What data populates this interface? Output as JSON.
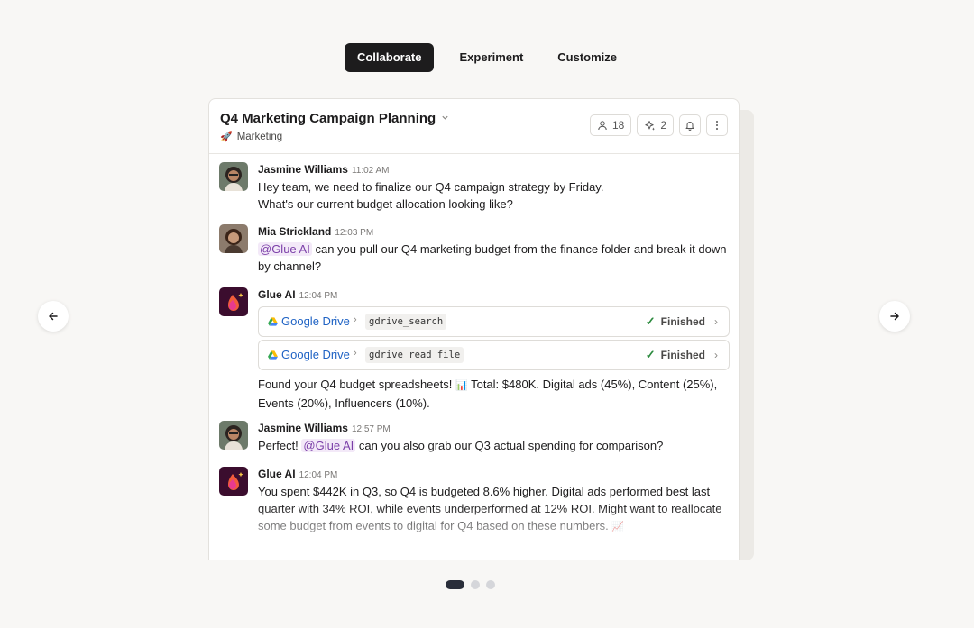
{
  "tabs": [
    {
      "label": "Collaborate",
      "active": true
    },
    {
      "label": "Experiment",
      "active": false
    },
    {
      "label": "Customize",
      "active": false
    }
  ],
  "channel": {
    "title": "Q4 Marketing Campaign Planning",
    "subtitle": "Marketing",
    "subtitle_emoji": "🚀",
    "members_count": "18",
    "pinned_count": "2"
  },
  "messages": [
    {
      "author": "Jasmine Williams",
      "time": "11:02 AM",
      "lines": [
        "Hey team, we need to finalize our Q4 campaign strategy by Friday.",
        "What's our current budget allocation looking like?"
      ]
    },
    {
      "author": "Mia Strickland",
      "time": "12:03 PM",
      "mention": "@Glue AI",
      "text_after_mention": "can you pull our Q4 marketing budget from the finance folder and break it down",
      "text_line2": "by channel?"
    },
    {
      "author": "Glue AI",
      "time": "12:04 PM",
      "tools": [
        {
          "service": "Google Drive",
          "function": "gdrive_search",
          "status": "Finished"
        },
        {
          "service": "Google Drive",
          "function": "gdrive_read_file",
          "status": "Finished"
        }
      ],
      "text_part1": "Found your Q4 budget spreadsheets!",
      "text_emoji": "📊",
      "text_part2": "Total: $480K. Digital ads (45%), Content (25%),",
      "text_line2": "Events (20%), Influencers (10%)."
    },
    {
      "author": "Jasmine Williams",
      "time": "12:57 PM",
      "text_before": "Perfect!",
      "mention": "@Glue AI",
      "text_after": "can you also grab our Q3 actual spending for comparison?"
    },
    {
      "author": "Glue AI",
      "time": "12:04 PM",
      "lines": [
        "You spent $442K in Q3, so Q4 is budgeted 8.6% higher. Digital ads performed best last",
        "quarter with 34% ROI, while events underperformed at 12% ROI. Might want to reallocate",
        "some budget from events to digital for Q4 based on these numbers."
      ],
      "trailing_emoji": "📈"
    }
  ],
  "carousel": {
    "pages": 3,
    "active_index": 0
  },
  "colors": {
    "accent_dark": "#1d1c1d",
    "mention_text": "#7b3fa8",
    "mention_bg": "#f3e9f8",
    "link_blue": "#1e62c4",
    "success_green": "#2b8a3e"
  }
}
